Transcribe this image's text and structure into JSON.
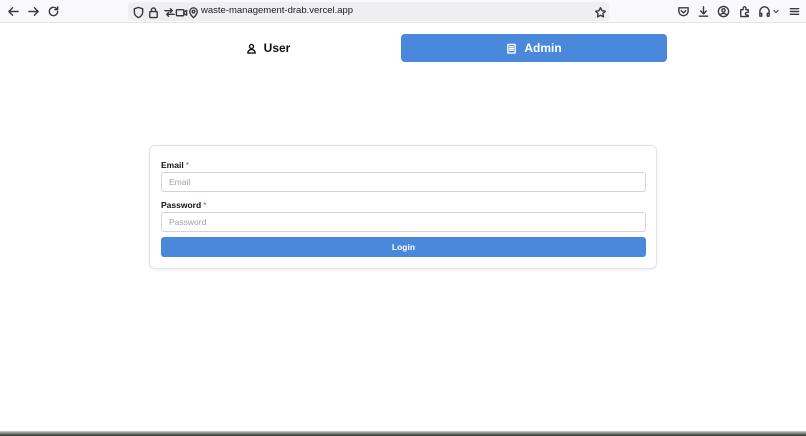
{
  "browser": {
    "url": "waste-management-drab.vercel.app"
  },
  "role_switch": {
    "user_label": "User",
    "admin_label": "Admin",
    "active": "Admin",
    "active_color": "#4a88dc"
  },
  "login_form": {
    "email_label": "Email",
    "email_placeholder": "Email",
    "email_value": "",
    "password_label": "Password",
    "password_placeholder": "Password",
    "password_value": "",
    "required_mark": "*",
    "login_label": "Login",
    "button_color": "#4a88dc"
  }
}
